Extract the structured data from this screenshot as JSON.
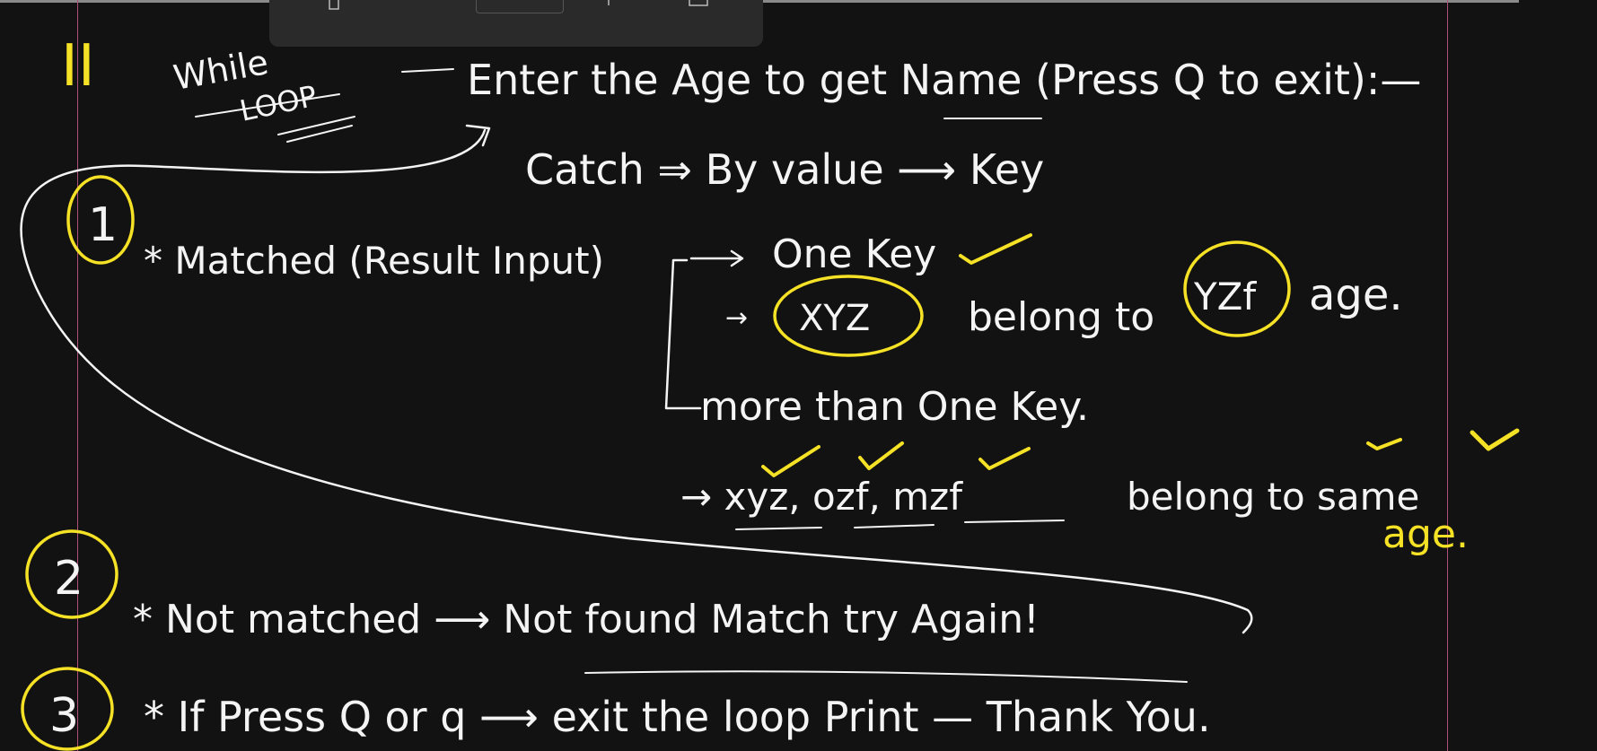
{
  "toolbar": {
    "tools": [
      "page-icon",
      "zoom-box",
      "pen-icon",
      "eraser-icon"
    ]
  },
  "colors": {
    "ink": "#f4f4f4",
    "highlight": "#f5e125",
    "background": "#121212",
    "margin": "#b0507a"
  },
  "note": {
    "section_mark": "II",
    "title_line1": "While",
    "title_line2": "LOOP",
    "heading": "Enter the Age to get Name (Press Q to exit):—",
    "catch": "Catch ⇒ By value ⟶ Key",
    "n1": "1",
    "case1": "* Matched (Result Input)",
    "one_key": "One Key",
    "one_key_example_name": "XYZ",
    "one_key_example_mid": "belong to",
    "one_key_example_age": "YZf",
    "one_key_example_end": "age.",
    "more_keys": "more than One Key.",
    "multi_names": "→ xyz, ozf, mzf",
    "multi_mid": "belong to same",
    "multi_age": "age.",
    "n2": "2",
    "case2": "* Not matched ⟶ Not found Match try Again!",
    "n3": "3",
    "case3": "* If Press Q or q ⟶ exit the loop Print — Thank You."
  }
}
